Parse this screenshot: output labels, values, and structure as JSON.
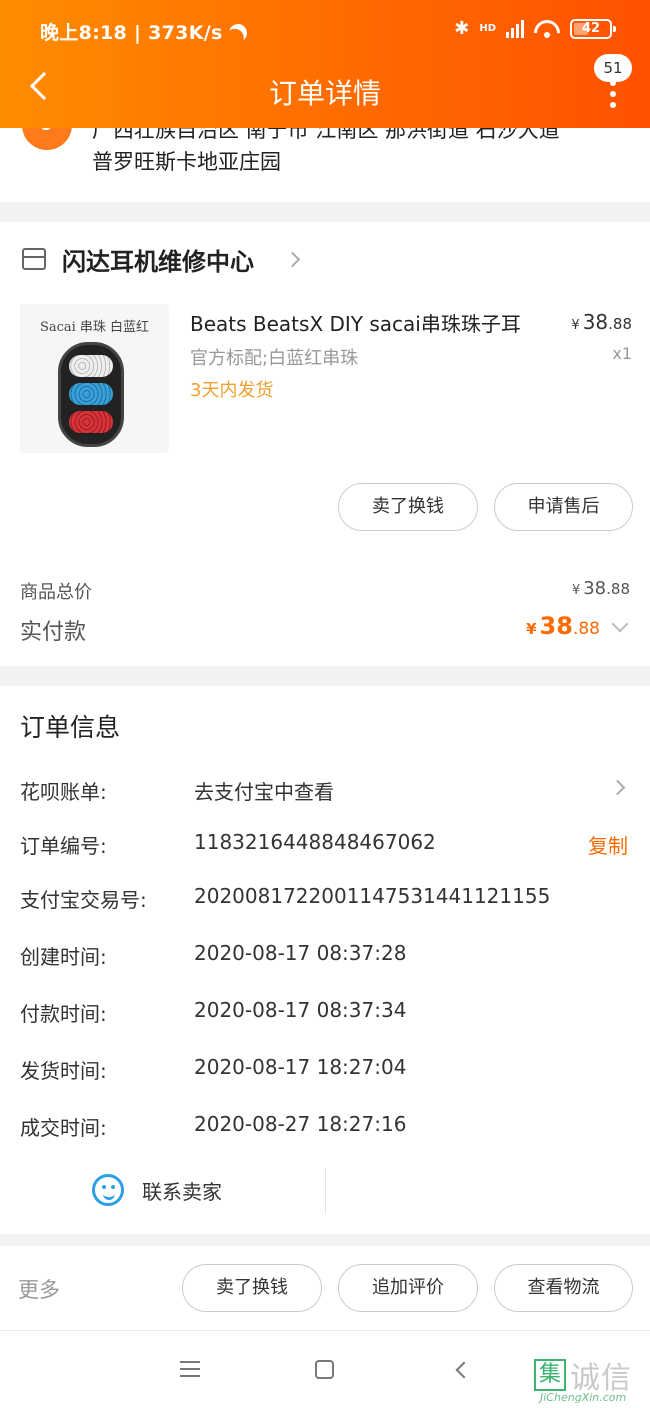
{
  "status_bar": {
    "time_speed": "晚上8:18 | 373K/s",
    "network_label": "HD",
    "battery": "42"
  },
  "nav": {
    "title": "订单详情",
    "badge_count": "51"
  },
  "address": {
    "line1": "广西壮族自治区 南宁市 江南区 那洪街道 石沙大道",
    "line2": "普罗旺斯卡地亚庄园"
  },
  "shop": {
    "name": "闪达耳机维修中心",
    "product": {
      "image_caption": "Sacai 串珠 白蓝红",
      "title": "Beats BeatsX DIY sacai串珠珠子耳",
      "spec": "官方标配;白蓝红串珠",
      "ship_note": "3天内发货",
      "price_currency": "¥",
      "price_int": "38",
      "price_dec": ".88",
      "qty": "x1"
    },
    "buttons": {
      "sell": "卖了换钱",
      "after_sale": "申请售后"
    },
    "total_label": "商品总价",
    "total_currency": "¥",
    "total_int": "38",
    "total_dec": ".88",
    "paid_label": "实付款",
    "paid_currency": "¥",
    "paid_int": "38",
    "paid_dec": ".88"
  },
  "order_info": {
    "title": "订单信息",
    "rows": [
      {
        "label": "花呗账单:",
        "value": "去支付宝中查看"
      },
      {
        "label": "订单编号:",
        "value": "1183216448848467062",
        "action": "复制"
      },
      {
        "label": "支付宝交易号:",
        "value": "2020081722001147531441121155"
      },
      {
        "label": "创建时间:",
        "value": "2020-08-17 08:37:28"
      },
      {
        "label": "付款时间:",
        "value": "2020-08-17 08:37:34"
      },
      {
        "label": "发货时间:",
        "value": "2020-08-17 18:27:04"
      },
      {
        "label": "成交时间:",
        "value": "2020-08-27 18:27:16"
      }
    ],
    "contact": "联系卖家"
  },
  "actions": {
    "more": "更多",
    "sell": "卖了换钱",
    "add_review": "追加评价",
    "logistics": "查看物流"
  },
  "watermark": {
    "box": "集",
    "text": "诚信",
    "url": "JiChengXin.com"
  },
  "colors": {
    "accent": "#ff6a00",
    "header_start": "#ff8c00",
    "ship_note": "#f0a030",
    "contact_icon": "#2ba0e6"
  }
}
